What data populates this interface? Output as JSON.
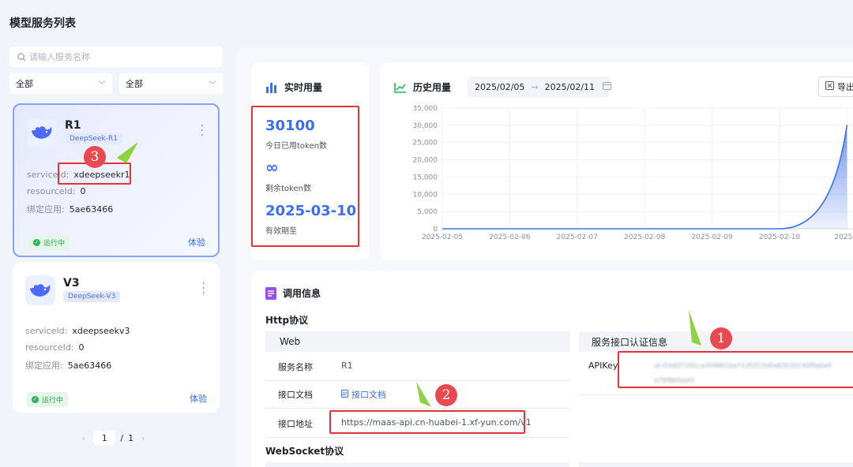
{
  "page": {
    "title": "模型服务列表"
  },
  "search": {
    "placeholder": "请输入服务名称"
  },
  "filters": [
    {
      "value": "全部"
    },
    {
      "value": "全部"
    }
  ],
  "services": [
    {
      "name": "R1",
      "tag": "DeepSeek-R1",
      "serviceId_label": "serviceId:",
      "serviceId": "xdeepseekr1",
      "resourceId_label": "resourceId:",
      "resourceId": "0",
      "app_label": "绑定应用:",
      "app": "5ae63466",
      "status": "运行中",
      "action": "体验"
    },
    {
      "name": "V3",
      "tag": "DeepSeek-V3",
      "serviceId_label": "serviceId:",
      "serviceId": "xdeepseekv3",
      "resourceId_label": "resourceId:",
      "resourceId": "0",
      "app_label": "绑定应用:",
      "app": "5ae63466",
      "status": "运行中",
      "action": "体验"
    }
  ],
  "pagination": {
    "current": "1",
    "separator": "/",
    "total": "1"
  },
  "realtime": {
    "title": "实时用量",
    "used_value": "30100",
    "used_label": "今日已用token数",
    "remaining_value": "∞",
    "remaining_label": "剩余token数",
    "expiry_value": "2025-03-10",
    "expiry_label": "有效期至"
  },
  "history": {
    "title": "历史用量",
    "date_start": "2025/02/05",
    "date_end": "2025/02/11",
    "export_label": "导出"
  },
  "chart_data": {
    "type": "area",
    "x": [
      "2025-02-05",
      "2025-02-06",
      "2025-02-07",
      "2025-02-08",
      "2025-02-09",
      "2025-02-10",
      "2025-02-11"
    ],
    "x_tick_labels": [
      "2025-02-05",
      "2025-02-06",
      "2025-02-07",
      "2025-02-08",
      "2025-02-09",
      "2025-02-10",
      "2025-0"
    ],
    "y": [
      0,
      0,
      0,
      0,
      0,
      0,
      30100
    ],
    "y_ticks": [
      "0",
      "5,000",
      "10,000",
      "15,000",
      "20,000",
      "25,000",
      "30,000",
      "35,000"
    ],
    "ylim": [
      0,
      35000
    ],
    "color": "#3e6ef0",
    "grid": true
  },
  "invoke": {
    "title": "调用信息",
    "http_title": "Http协议",
    "web_header": "Web",
    "rows": [
      {
        "key": "服务名称",
        "value": "R1"
      },
      {
        "key": "接口文档",
        "value": "接口文档"
      },
      {
        "key": "接口地址",
        "value": "https://maas-api.cn-huabei-1.xf-yun.com/v1"
      }
    ],
    "auth_header": "服务接口认证信息",
    "apikey_label": "APIKey",
    "apikey_masked_1": "sk-03d0f7291ca304861ba712f2f23d5a83b30140f0a0a9",
    "apikey_masked_2": "079f86f0d45",
    "ws_title": "WebSocket协议"
  },
  "annotations": {
    "badge1": "1",
    "badge2": "2",
    "badge3": "3"
  }
}
